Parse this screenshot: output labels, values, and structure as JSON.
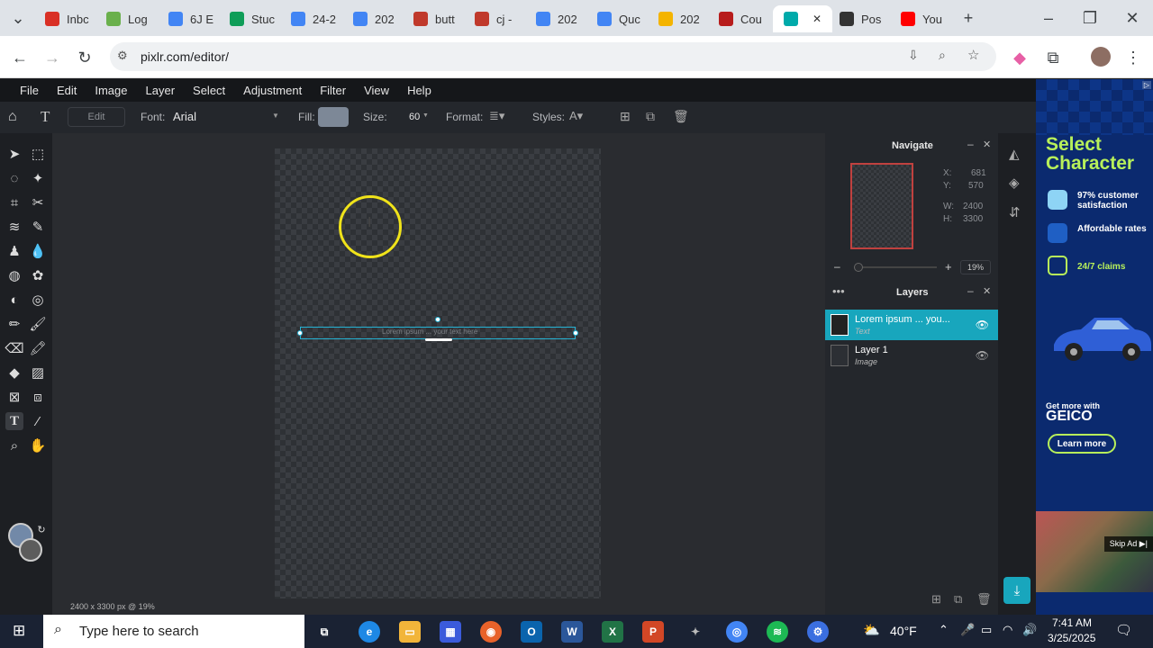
{
  "browser": {
    "tabs": [
      {
        "label": "Inbc",
        "icon": "gmail-icon",
        "color": "#d93025"
      },
      {
        "label": "Log",
        "icon": "classlink-icon",
        "color": "#6ab04c"
      },
      {
        "label": "6J E",
        "icon": "docs-icon",
        "color": "#4285f4"
      },
      {
        "label": "Stuc",
        "icon": "sheets-icon",
        "color": "#0f9d58"
      },
      {
        "label": "24-2",
        "icon": "docs-icon",
        "color": "#4285f4"
      },
      {
        "label": "202",
        "icon": "docs-icon",
        "color": "#4285f4"
      },
      {
        "label": "butt",
        "icon": "app-icon",
        "color": "#c0392b"
      },
      {
        "label": "cj -",
        "icon": "app-icon",
        "color": "#c0392b"
      },
      {
        "label": "202",
        "icon": "docs-icon",
        "color": "#4285f4"
      },
      {
        "label": "Quc",
        "icon": "docs-icon",
        "color": "#4285f4"
      },
      {
        "label": "202",
        "icon": "slides-icon",
        "color": "#f4b400"
      },
      {
        "label": "Cou",
        "icon": "course-icon",
        "color": "#b71c1c"
      },
      {
        "label": "",
        "icon": "pixlr-icon",
        "color": "#0aa"
      },
      {
        "label": "Pos",
        "icon": "poster-icon",
        "color": "#333"
      },
      {
        "label": "You",
        "icon": "youtube-icon",
        "color": "#ff0000"
      }
    ],
    "url": "pixlr.com/editor/"
  },
  "menu": [
    "File",
    "Edit",
    "Image",
    "Layer",
    "Select",
    "Adjustment",
    "Filter",
    "View",
    "Help"
  ],
  "toolopts": {
    "edit": "Edit",
    "font_label": "Font:",
    "font_value": "Arial",
    "fill_label": "Fill:",
    "size_label": "Size:",
    "size_value": "60",
    "format_label": "Format:",
    "styles_label": "Styles:"
  },
  "canvas": {
    "text": "Lorem ipsum ... your text here",
    "status": "2400 x 3300 px @ 19%"
  },
  "navigate": {
    "title": "Navigate",
    "x_label": "X:",
    "x_value": "681",
    "y_label": "Y:",
    "y_value": "570",
    "w_label": "W:",
    "w_value": "2400",
    "h_label": "H:",
    "h_value": "3300",
    "zoom": "19%"
  },
  "layers": {
    "title": "Layers",
    "items": [
      {
        "name": "Lorem ipsum ... you...",
        "type": "Text"
      },
      {
        "name": "Layer 1",
        "type": "Image"
      }
    ]
  },
  "ad": {
    "headline": "Select Character",
    "features": [
      "97% customer satisfaction",
      "Affordable rates",
      "24/7 claims"
    ],
    "more": "Get more with",
    "brand": "GEICO",
    "cta": "Learn more",
    "skip": "Skip Ad"
  },
  "taskbar": {
    "search_placeholder": "Type here to search",
    "weather": "40°F",
    "time": "7:41 AM",
    "date": "3/25/2025"
  }
}
